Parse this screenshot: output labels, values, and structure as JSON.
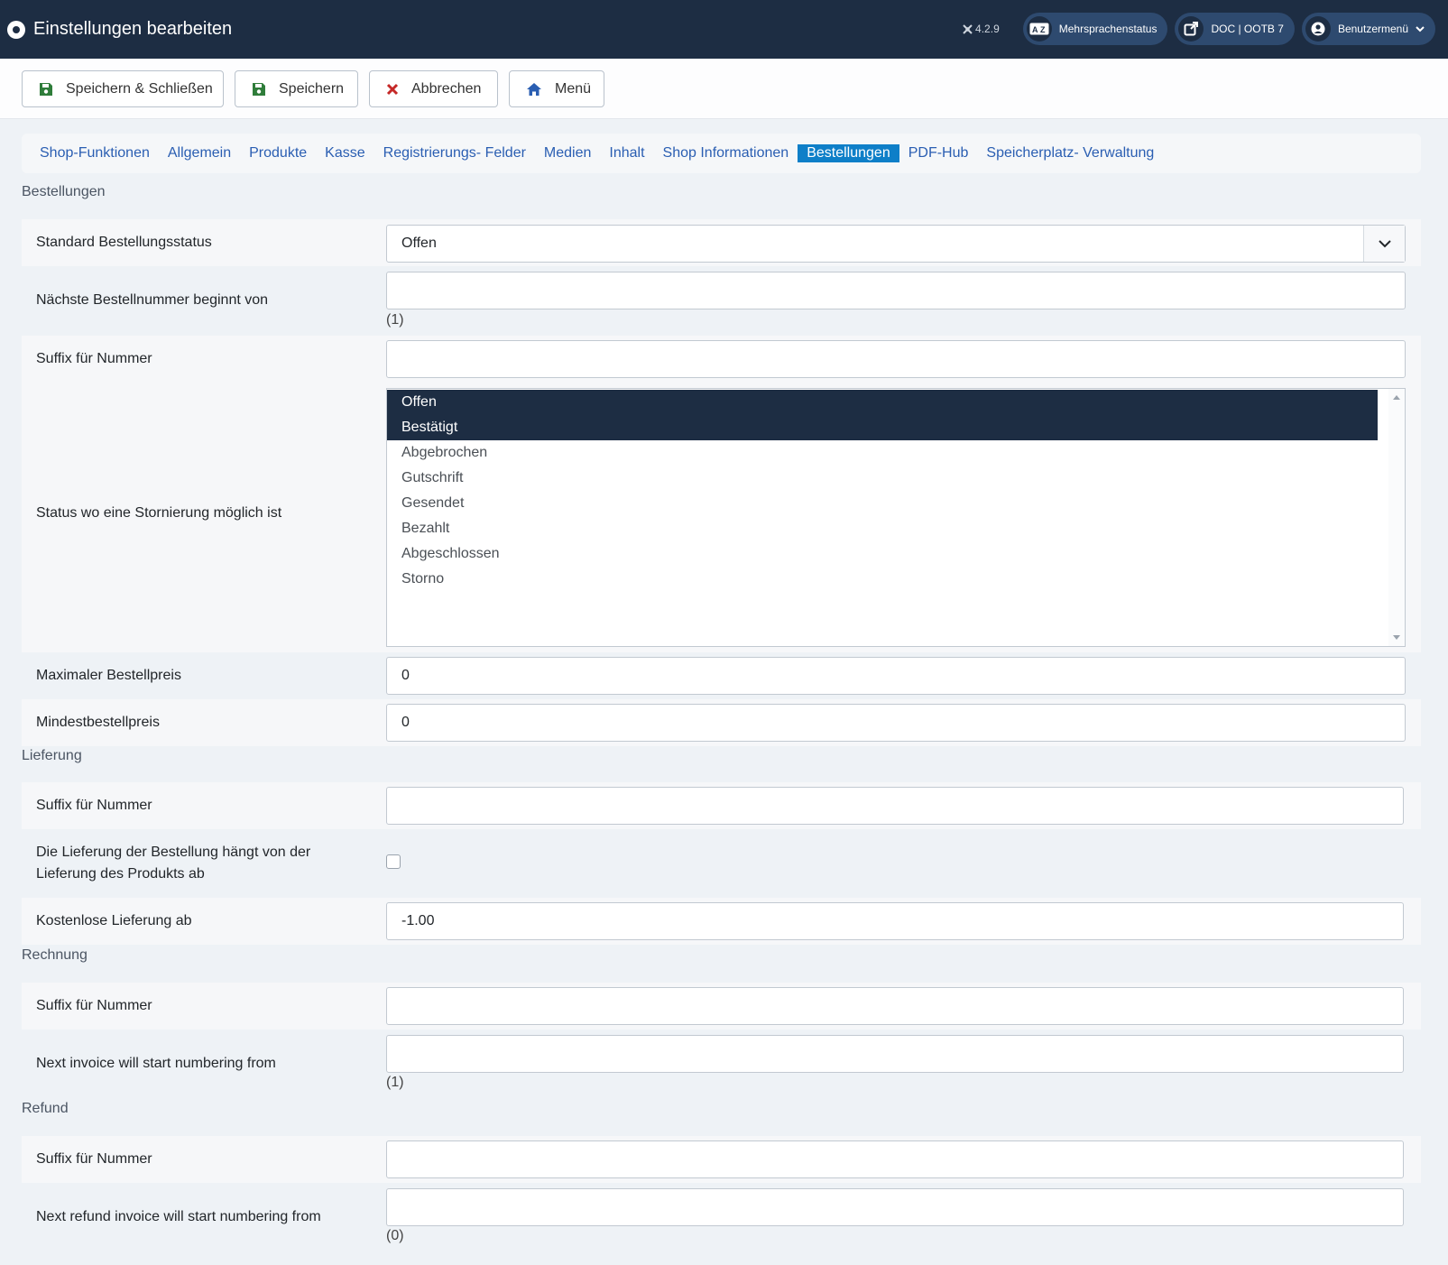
{
  "header": {
    "title": "Einstellungen bearbeiten",
    "version": "4.2.9",
    "multilang": "Mehrsprachenstatus",
    "multilang_icon": "AZ",
    "doc": "DOC | OOTB 7",
    "user_menu": "Benutzermenü"
  },
  "toolbar": {
    "save_close": "Speichern & Schließen",
    "save": "Speichern",
    "cancel": "Abbrechen",
    "menu": "Menü"
  },
  "tabs": [
    "Shop-Funktionen",
    "Allgemein",
    "Produkte",
    "Kasse",
    "Registrierungs- Felder",
    "Medien",
    "Inhalt",
    "Shop Informationen",
    "Bestellungen",
    "PDF-Hub",
    "Speicherplatz- Verwaltung"
  ],
  "active_tab": "Bestellungen",
  "orders": {
    "title": "Bestellungen",
    "default_status_label": "Standard Bestellungsstatus",
    "default_status_value": "Offen",
    "next_number_label": "Nächste Bestellnummer beginnt von",
    "next_number_value": "",
    "next_number_hint": "(1)",
    "suffix_label": "Suffix für Nummer",
    "suffix_value": "",
    "cancel_status_label": "Status wo eine Stornierung möglich ist",
    "cancel_status_options": [
      "Offen",
      "Bestätigt",
      "Abgebrochen",
      "Gutschrift",
      "Gesendet",
      "Bezahlt",
      "Abgeschlossen",
      "Storno"
    ],
    "cancel_status_selected": [
      "Offen",
      "Bestätigt"
    ],
    "max_price_label": "Maximaler Bestellpreis",
    "max_price_value": "0",
    "min_price_label": "Mindestbestellpreis",
    "min_price_value": "0"
  },
  "delivery": {
    "title": "Lieferung",
    "suffix_label": "Suffix für Nummer",
    "suffix_value": "",
    "depends_label_line1": "Die Lieferung der Bestellung hängt von der",
    "depends_label_line2": "Lieferung des Produkts ab",
    "depends_checked": false,
    "free_label": "Kostenlose Lieferung ab",
    "free_value": "-1.00"
  },
  "invoice": {
    "title": "Rechnung",
    "suffix_label": "Suffix für Nummer",
    "suffix_value": "",
    "next_label": "Next invoice will start numbering from",
    "next_value": "",
    "next_hint": "(1)"
  },
  "refund": {
    "title": "Refund",
    "suffix_label": "Suffix für Nummer",
    "suffix_value": "",
    "next_label": "Next refund invoice will start numbering from",
    "next_value": "",
    "next_hint": "(0)"
  },
  "colors": {
    "header_bg": "#1d2d43",
    "pill_bg": "#2e4a6f",
    "active_tab": "#0e7fc8",
    "link": "#2a5eb2",
    "save_icon": "#2f7d3a",
    "cancel_icon": "#c52827",
    "home_icon": "#2a5eb2"
  },
  "icons": {
    "logo": "joomla-logo-icon",
    "save": "floppy-disk-icon",
    "cancel": "x-icon",
    "menu": "home-icon",
    "multilang": "language-icon",
    "doc": "external-link-icon",
    "user": "user-circle-icon"
  }
}
